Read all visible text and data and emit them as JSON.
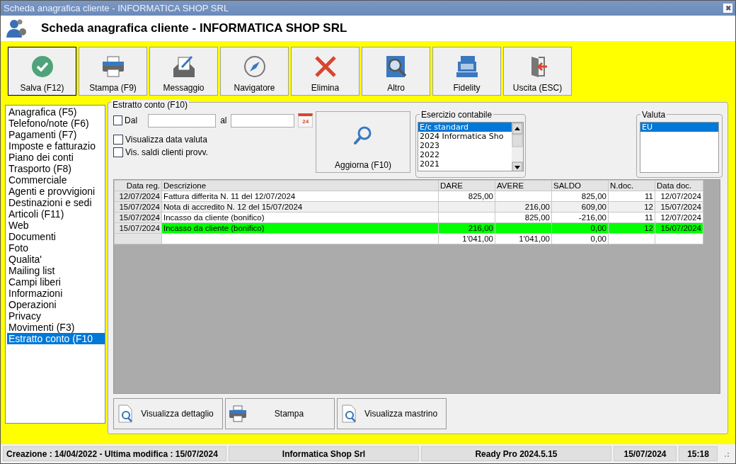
{
  "window": {
    "title": "Scheda anagrafica cliente - INFORMATICA SHOP SRL",
    "close": "✖"
  },
  "header": {
    "title": "Scheda anagrafica cliente - INFORMATICA SHOP SRL"
  },
  "toolbar": [
    {
      "label": "Salva (F12)",
      "selected": true
    },
    {
      "label": "Stampa (F9)",
      "selected": false
    },
    {
      "label": "Messaggio",
      "selected": false
    },
    {
      "label": "Navigatore",
      "selected": false
    },
    {
      "label": "Elimina",
      "selected": false
    },
    {
      "label": "Altro",
      "selected": false
    },
    {
      "label": "Fidelity",
      "selected": false
    },
    {
      "label": "Uscita (ESC)",
      "selected": false
    }
  ],
  "sidebar": {
    "items": [
      {
        "label": "Anagrafica (F5)",
        "selected": false
      },
      {
        "label": "Telefono/note (F6)",
        "selected": false
      },
      {
        "label": "Pagamenti (F7)",
        "selected": false
      },
      {
        "label": "Imposte e fatturazio",
        "selected": false
      },
      {
        "label": "Piano dei conti",
        "selected": false
      },
      {
        "label": "Trasporto (F8)",
        "selected": false
      },
      {
        "label": "Commerciale",
        "selected": false
      },
      {
        "label": "Agenti e provvigioni",
        "selected": false
      },
      {
        "label": "Destinazioni e sedi",
        "selected": false
      },
      {
        "label": "Articoli (F11)",
        "selected": false
      },
      {
        "label": "Web",
        "selected": false
      },
      {
        "label": "Documenti",
        "selected": false
      },
      {
        "label": "Foto",
        "selected": false
      },
      {
        "label": "Qualita'",
        "selected": false
      },
      {
        "label": "Mailing list",
        "selected": false
      },
      {
        "label": "Campi liberi",
        "selected": false
      },
      {
        "label": "Informazioni",
        "selected": false
      },
      {
        "label": "Operazioni",
        "selected": false
      },
      {
        "label": "Privacy",
        "selected": false
      },
      {
        "label": "Movimenti (F3)",
        "selected": false
      },
      {
        "label": "Estratto conto (F10",
        "selected": true
      }
    ]
  },
  "panel": {
    "title": "Estratto conto (F10)",
    "dal": {
      "label": "Dal",
      "checked": false
    },
    "al_label": "al",
    "calendar_day": "24",
    "options": [
      {
        "label": "Visualizza data valuta",
        "checked": false
      },
      {
        "label": "Vis. saldi clienti provv.",
        "checked": false
      }
    ],
    "refresh_button": "Aggiorna (F10)",
    "esercizio": {
      "title": "Esercizio contabile",
      "items": [
        {
          "label": "E/c standard",
          "selected": true
        },
        {
          "label": "2024 Informatica Sho",
          "selected": false
        },
        {
          "label": "2023",
          "selected": false
        },
        {
          "label": "2022",
          "selected": false
        },
        {
          "label": "2021",
          "selected": false
        }
      ]
    },
    "valuta": {
      "title": "Valuta",
      "items": [
        {
          "label": "EU",
          "selected": true
        }
      ]
    },
    "table": {
      "columns": [
        "Data reg.",
        "Descrizione",
        "DARE",
        "AVERE",
        "SALDO",
        "N.doc.",
        "Data doc."
      ],
      "rows": [
        {
          "data_reg": "12/07/2024",
          "descrizione": "Fattura differita N. 11 del 12/07/2024",
          "dare": "825,00",
          "saldo": "825,00",
          "n_doc": "11",
          "data_doc": "12/07/2024",
          "highlighted": false
        },
        {
          "data_reg": "15/07/2024",
          "descrizione": "Nota di accredito N. 12 del 15/07/2024",
          "avere": "216,00",
          "saldo": "609,00",
          "n_doc": "12",
          "data_doc": "15/07/2024",
          "highlighted": false
        },
        {
          "data_reg": "15/07/2024",
          "descrizione": "Incasso da cliente (bonifico)",
          "avere": "825,00",
          "saldo": "-216,00",
          "n_doc": "11",
          "data_doc": "12/07/2024",
          "highlighted": false
        },
        {
          "data_reg": "15/07/2024",
          "descrizione": "Incasso da cliente (bonifico)",
          "dare": "216,00",
          "saldo": "0,00",
          "n_doc": "12",
          "data_doc": "15/07/2024",
          "highlighted": true
        }
      ],
      "totals": {
        "dare": "1'041,00",
        "avere": "1'041,00",
        "saldo": "0,00"
      }
    },
    "bottom_buttons": [
      "Visualizza dettaglio",
      "Stampa",
      "Visualizza mastrino"
    ]
  },
  "status_bar": [
    "Creazione : 14/04/2022 - Ultima modifica : 15/07/2024",
    "Informatica Shop Srl",
    "Ready Pro 2024.5.15",
    "15/07/2024",
    "15:18"
  ]
}
